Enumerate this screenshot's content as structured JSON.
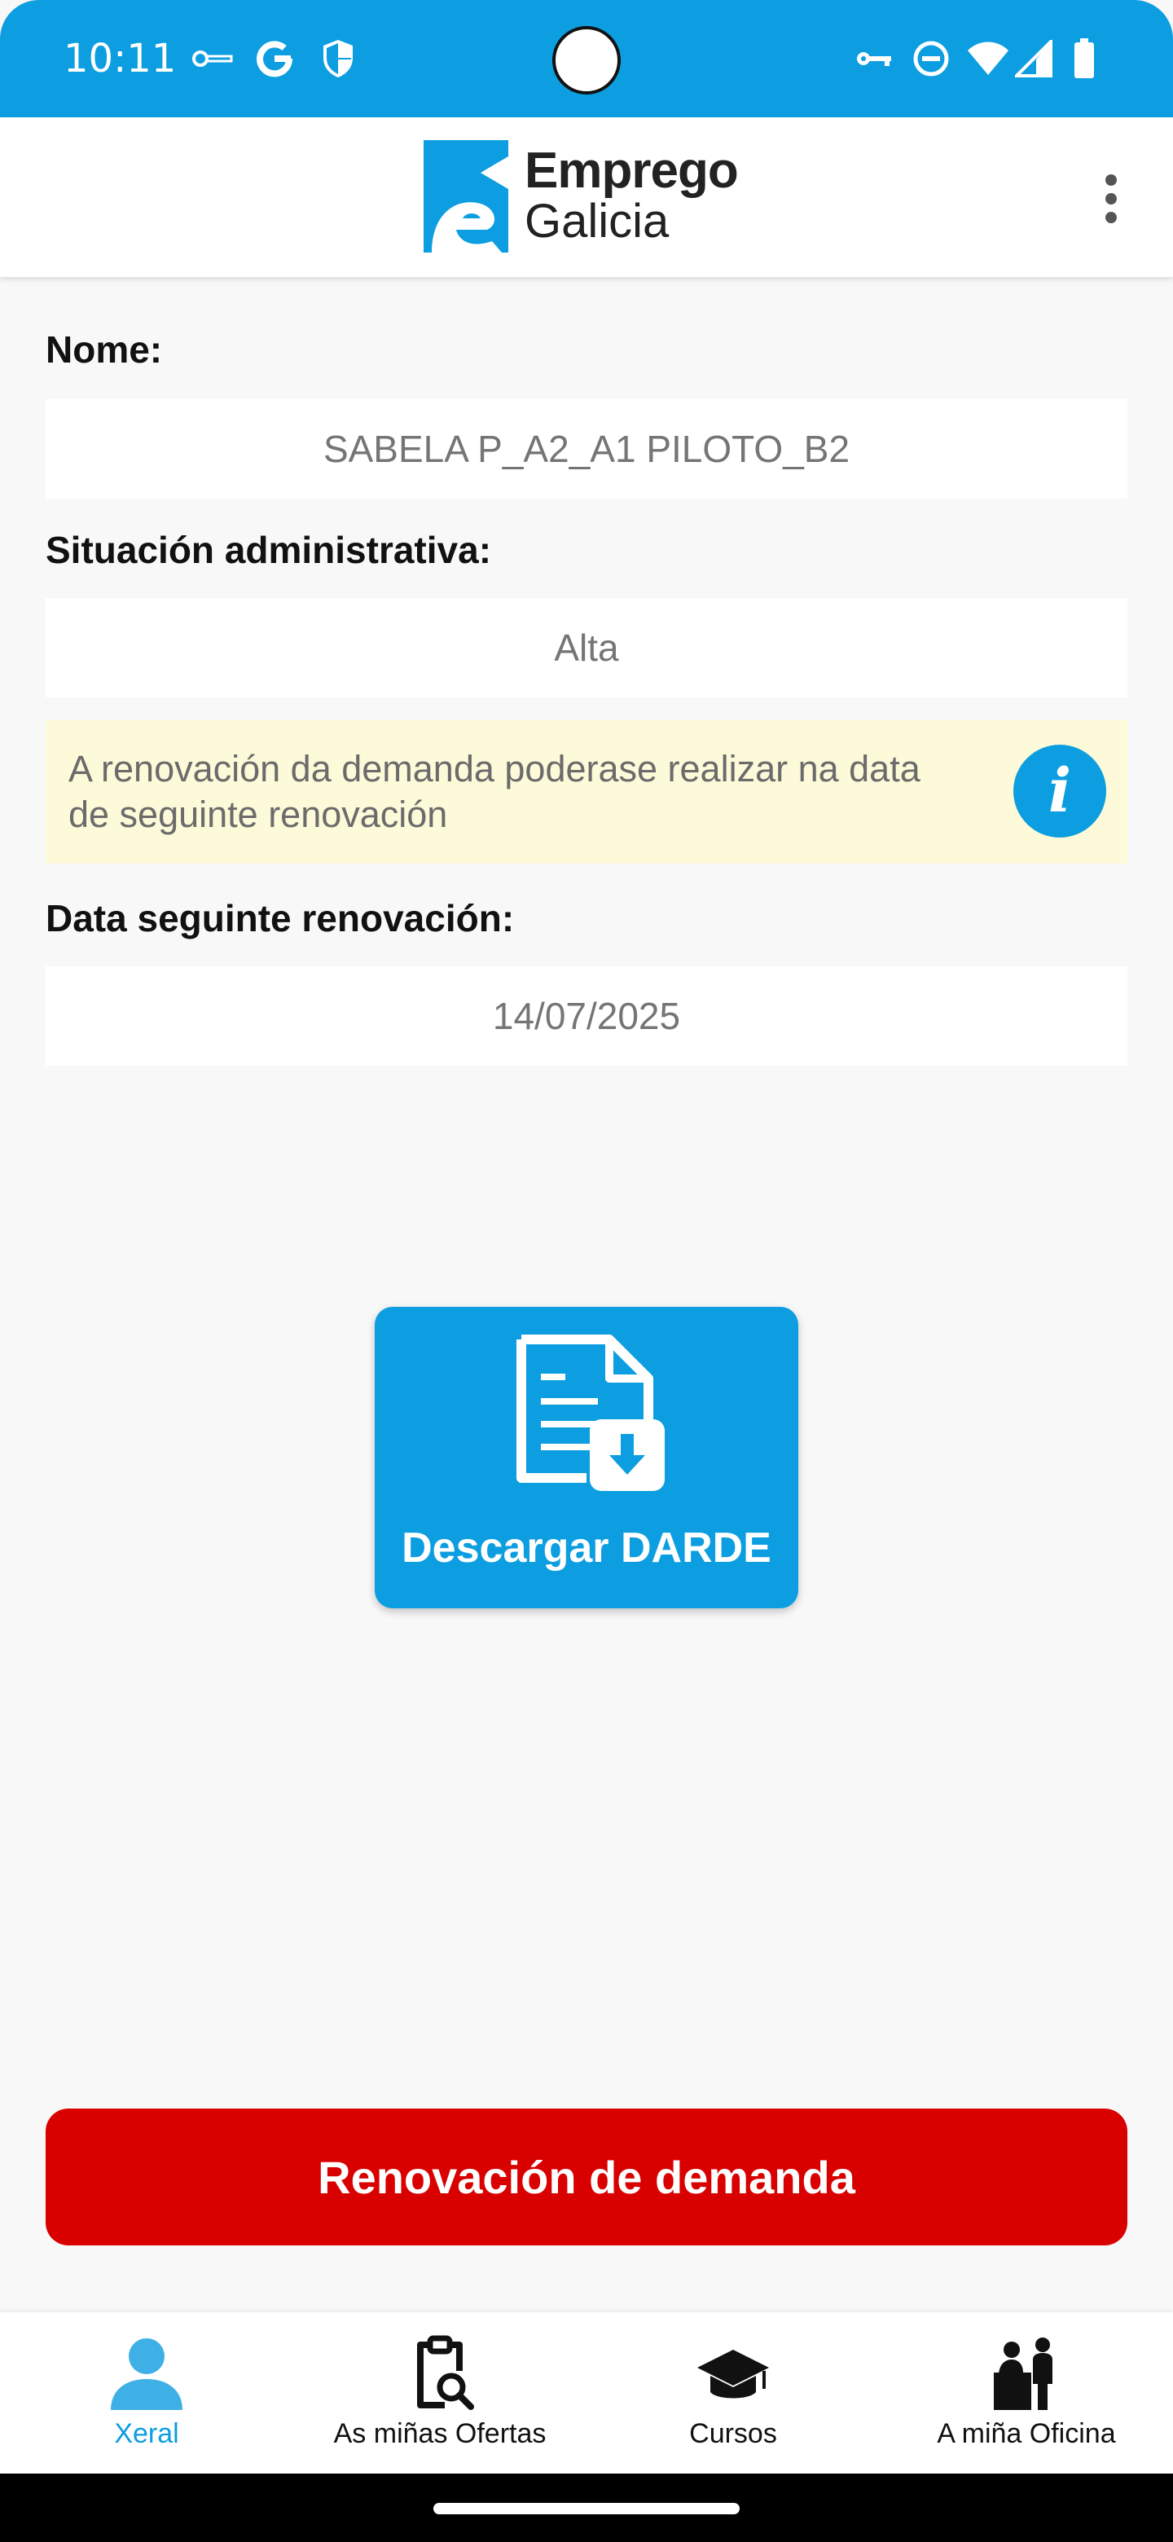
{
  "status_bar": {
    "time": "10:11",
    "icons_left": [
      "vpn-key-outline-icon",
      "google-icon",
      "shield-icon"
    ],
    "icons_right": [
      "key-icon",
      "do-not-disturb-icon",
      "wifi-icon",
      "signal-icon",
      "battery-icon"
    ]
  },
  "app_bar": {
    "logo_line1": "Emprego",
    "logo_line2": "Galicia",
    "menu_icon": "more-vert-icon"
  },
  "form": {
    "nome_label": "Nome:",
    "nome_value": "SABELA P_A2_A1 PILOTO_B2",
    "situacion_label": "Situación administrativa:",
    "situacion_value": "Alta",
    "notice_text": "A renovación da demanda poderase realizar na data de seguinte renovación",
    "data_label": "Data seguinte renovación:",
    "data_value": "14/07/2025"
  },
  "darde_button": {
    "label": "Descargar DARDE",
    "icon": "document-download-icon"
  },
  "renew_button": {
    "label": "Renovación de demanda"
  },
  "bottom_nav": {
    "items": [
      {
        "label": "Xeral",
        "icon": "person-icon",
        "active": true
      },
      {
        "label": "As miñas Ofertas",
        "icon": "clipboard-search-icon",
        "active": false
      },
      {
        "label": "Cursos",
        "icon": "graduation-cap-icon",
        "active": false
      },
      {
        "label": "A miña Oficina",
        "icon": "office-desk-icon",
        "active": false
      }
    ]
  },
  "colors": {
    "accent": "#0c9ee0",
    "danger": "#d90000",
    "notice_bg": "#fcfad8"
  }
}
